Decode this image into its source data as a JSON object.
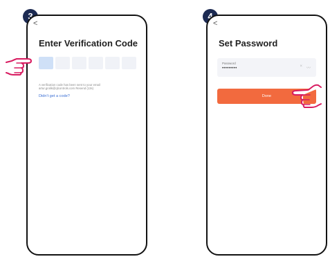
{
  "step1": {
    "number": "3",
    "back_glyph": "<",
    "title": "Enter Verification Code",
    "code_boxes": 6,
    "info_line1": "A verification code has been sent to your email",
    "info_line2": "artur.grolik@qlcontrols.com Resend (13s)",
    "link": "Didn't get a code?",
    "hand_icon": "pointing-hand-icon",
    "accent_color": "#cfe0f7"
  },
  "step2": {
    "number": "4",
    "back_glyph": "<",
    "title": "Set Password",
    "password_label": "Password",
    "password_value": "•••••••••",
    "clear_glyph": "×",
    "eye_glyph": "〰",
    "done_label": "Done",
    "hand_icon": "pointing-hand-icon",
    "button_color": "#f26a3e"
  },
  "colors": {
    "badge": "#1c2a52",
    "hand_outline": "#d81b60",
    "link": "#3b6fd4"
  }
}
